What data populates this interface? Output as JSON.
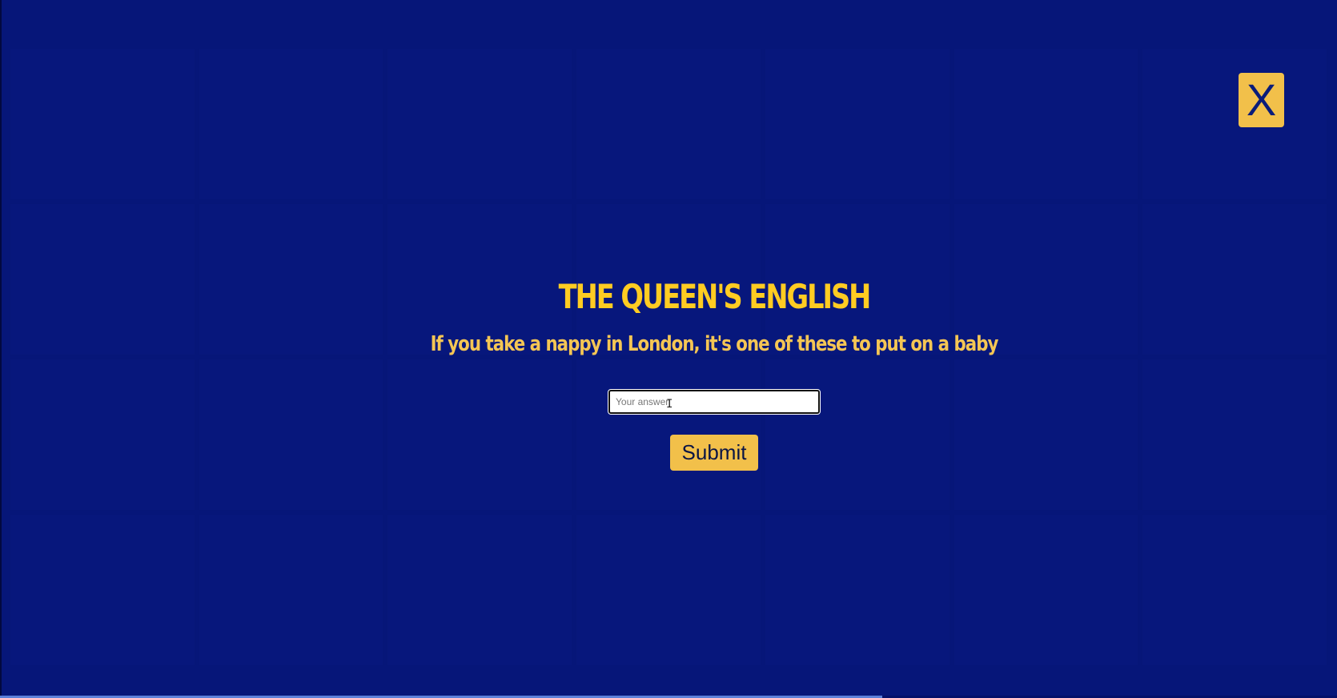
{
  "modal": {
    "close_label": "X",
    "category": "THE QUEEN'S ENGLISH",
    "clue": "If you take a nappy in London, it's one of these to put on a baby",
    "answer_placeholder": "Your answer",
    "answer_value": "",
    "submit_label": "Submit"
  },
  "colors": {
    "background": "#061679",
    "accent": "#f2c04a",
    "title": "#ffcc22",
    "button_text": "#0b1545"
  },
  "icons": {
    "cursor": "text-cursor-icon"
  },
  "progress": {
    "fraction": 0.66
  }
}
